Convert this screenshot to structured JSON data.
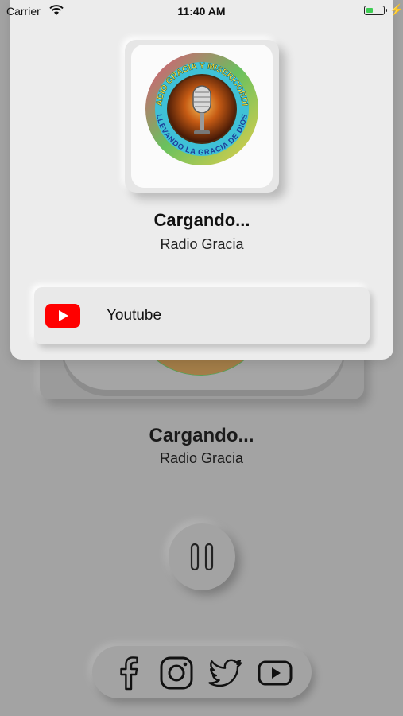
{
  "status_bar": {
    "carrier": "Carrier",
    "time": "11:40 AM",
    "battery_level": 0.4,
    "battery_color": "#3fcd54"
  },
  "modal": {
    "logo": {
      "top_text": "RADIO GRACIA Y MISERICORDIA",
      "bottom_text": "LLEVANDO LA GRACIA DE DIOS",
      "icon": "microphone-icon"
    },
    "title": "Cargando...",
    "subtitle": "Radio Gracia",
    "option": {
      "label": "Youtube",
      "icon": "youtube-icon",
      "icon_color": "#ff0000"
    }
  },
  "player": {
    "title": "Cargando...",
    "subtitle": "Radio Gracia",
    "control_icon": "pause-icon"
  },
  "social": {
    "icons": [
      "facebook-icon",
      "instagram-icon",
      "twitter-icon",
      "youtube-icon"
    ]
  }
}
